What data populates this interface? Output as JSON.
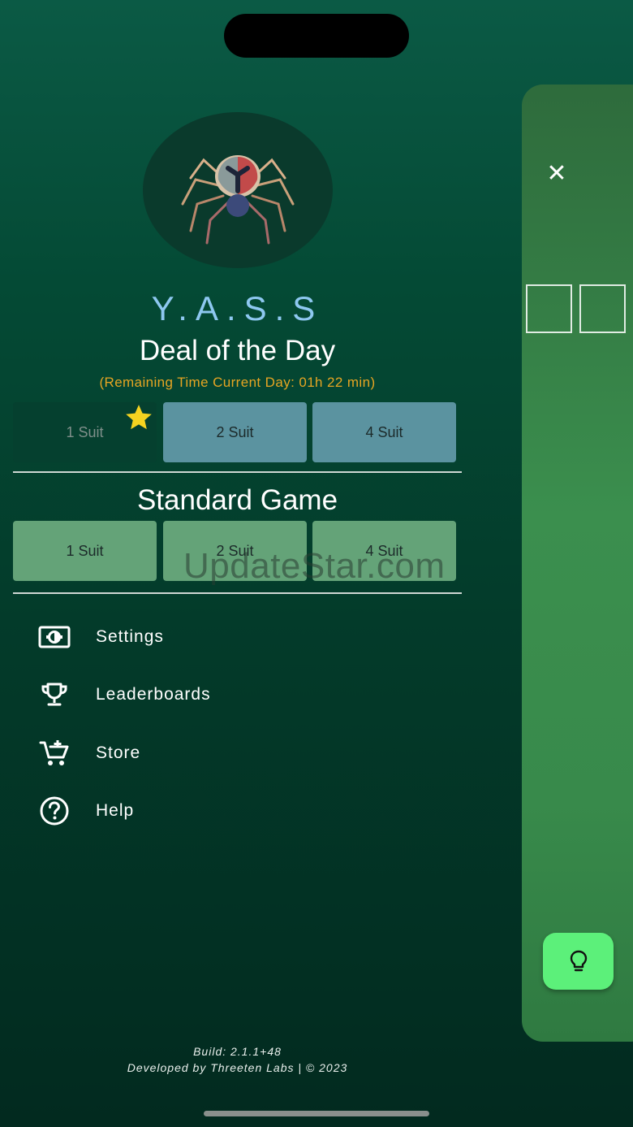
{
  "app": {
    "title": "Y.A.S.S"
  },
  "deal_of_the_day": {
    "title": "Deal of the Day",
    "remaining": "(Remaining Time Current Day: 01h 22 min)",
    "buttons": [
      {
        "label": "1 Suit",
        "completed": true
      },
      {
        "label": "2 Suit",
        "completed": false
      },
      {
        "label": "4 Suit",
        "completed": false
      }
    ]
  },
  "standard_game": {
    "title": "Standard Game",
    "buttons": [
      {
        "label": "1 Suit"
      },
      {
        "label": "2 Suit"
      },
      {
        "label": "4 Suit"
      }
    ]
  },
  "menu": [
    {
      "label": "Settings",
      "icon": "settings-icon"
    },
    {
      "label": "Leaderboards",
      "icon": "trophy-icon"
    },
    {
      "label": "Store",
      "icon": "cart-icon"
    },
    {
      "label": "Help",
      "icon": "help-icon"
    }
  ],
  "footer": {
    "build": "Build: 2.1.1+48",
    "developer": "Developed by Threeten Labs | © 2023"
  },
  "watermark": "UpdateStar.com",
  "colors": {
    "title_blue": "#8ec8f0",
    "remaining_orange": "#e6a523",
    "dotd_button": "#5b93a0",
    "standard_button": "#64a378",
    "hint_button": "#5cf07a",
    "star": "#f5d320"
  }
}
